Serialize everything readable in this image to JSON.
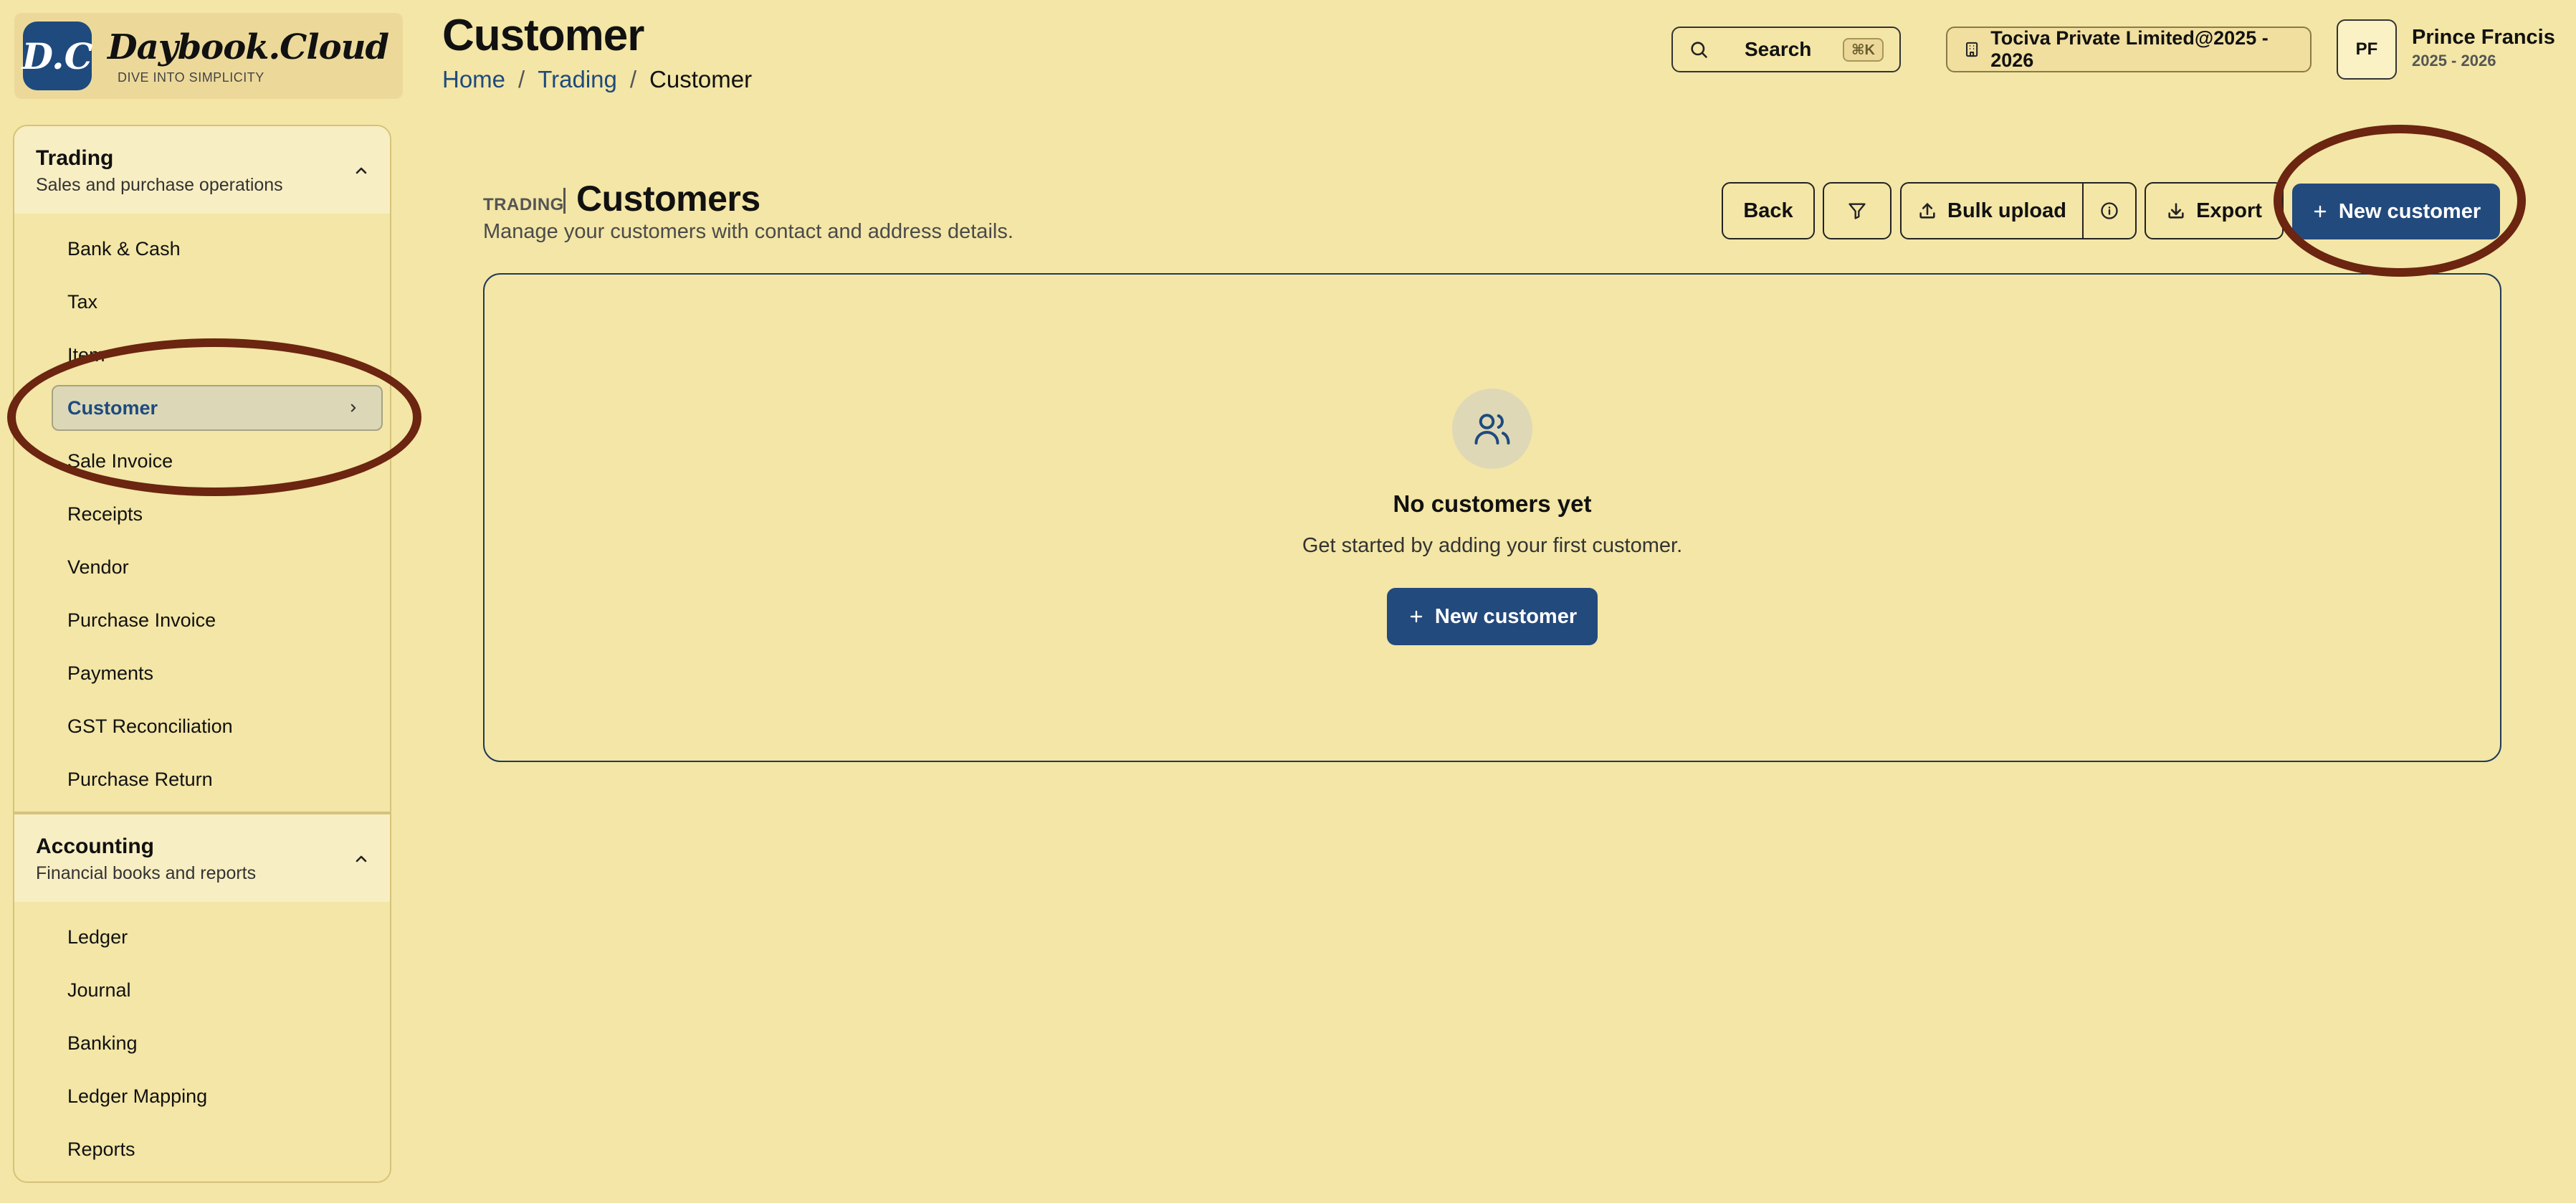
{
  "brand": {
    "badge": "D.C",
    "name": "Daybook.Cloud",
    "tagline": "DIVE INTO SIMPLICITY"
  },
  "header": {
    "title": "Customer",
    "breadcrumb": [
      "Home",
      "Trading",
      "Customer"
    ],
    "breadcrumb_sep": "/",
    "search_label": "Search",
    "search_shortcut": "⌘K",
    "company": "Tociva Private Limited@2025 - 2026",
    "user_initials": "PF",
    "user_name": "Prince Francis",
    "user_year": "2025 - 2026"
  },
  "sidebar": {
    "sections": [
      {
        "title": "Trading",
        "subtitle": "Sales and purchase operations",
        "items": [
          "Bank & Cash",
          "Tax",
          "Item",
          "Customer",
          "Sale Invoice",
          "Receipts",
          "Vendor",
          "Purchase Invoice",
          "Payments",
          "GST Reconciliation",
          "Purchase Return"
        ]
      },
      {
        "title": "Accounting",
        "subtitle": "Financial books and reports",
        "items": [
          "Ledger",
          "Journal",
          "Banking",
          "Ledger Mapping",
          "Reports"
        ]
      }
    ],
    "active_item": "Customer"
  },
  "main": {
    "eyebrow": "TRADING",
    "title": "Customers",
    "subtitle": "Manage your customers with contact and address details.",
    "toolbar": {
      "back": "Back",
      "bulk_upload": "Bulk upload",
      "export": "Export",
      "new_customer": "New customer"
    },
    "empty": {
      "title": "No customers yet",
      "subtitle": "Get started by adding your first customer.",
      "cta": "New customer"
    }
  },
  "colors": {
    "background": "#f3e6a6",
    "primary": "#234a7d",
    "annotation": "#6b2510"
  }
}
